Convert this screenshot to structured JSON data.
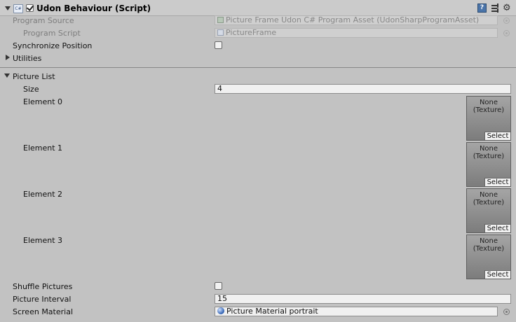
{
  "component": {
    "title": "Udon Behaviour (Script)",
    "enabled": true,
    "icons": [
      "cs-script-icon",
      "help-icon",
      "preset-icon",
      "gear-icon"
    ]
  },
  "program": {
    "source_label": "Program Source",
    "source_value": "Picture Frame Udon C# Program Asset (UdonSharpProgramAsset)",
    "script_label": "Program Script",
    "script_value": "PictureFrame"
  },
  "sync": {
    "label": "Synchronize Position",
    "checked": false
  },
  "utilities": {
    "label": "Utilities"
  },
  "picture_list": {
    "label": "Picture List",
    "size_label": "Size",
    "size_value": "4",
    "elements": [
      {
        "label": "Element 0",
        "none_text": "None",
        "type_text": "(Texture)",
        "select_label": "Select"
      },
      {
        "label": "Element 1",
        "none_text": "None",
        "type_text": "(Texture)",
        "select_label": "Select"
      },
      {
        "label": "Element 2",
        "none_text": "None",
        "type_text": "(Texture)",
        "select_label": "Select"
      },
      {
        "label": "Element 3",
        "none_text": "None",
        "type_text": "(Texture)",
        "select_label": "Select"
      }
    ]
  },
  "shuffle": {
    "label": "Shuffle Pictures",
    "checked": false
  },
  "interval": {
    "label": "Picture Interval",
    "value": "15"
  },
  "screen_material": {
    "label": "Screen Material",
    "value": "Picture Material portrait"
  },
  "colors": {
    "background": "#c2c2c2",
    "header": "#cbcbcb",
    "help_icon": "#4a74a9"
  }
}
